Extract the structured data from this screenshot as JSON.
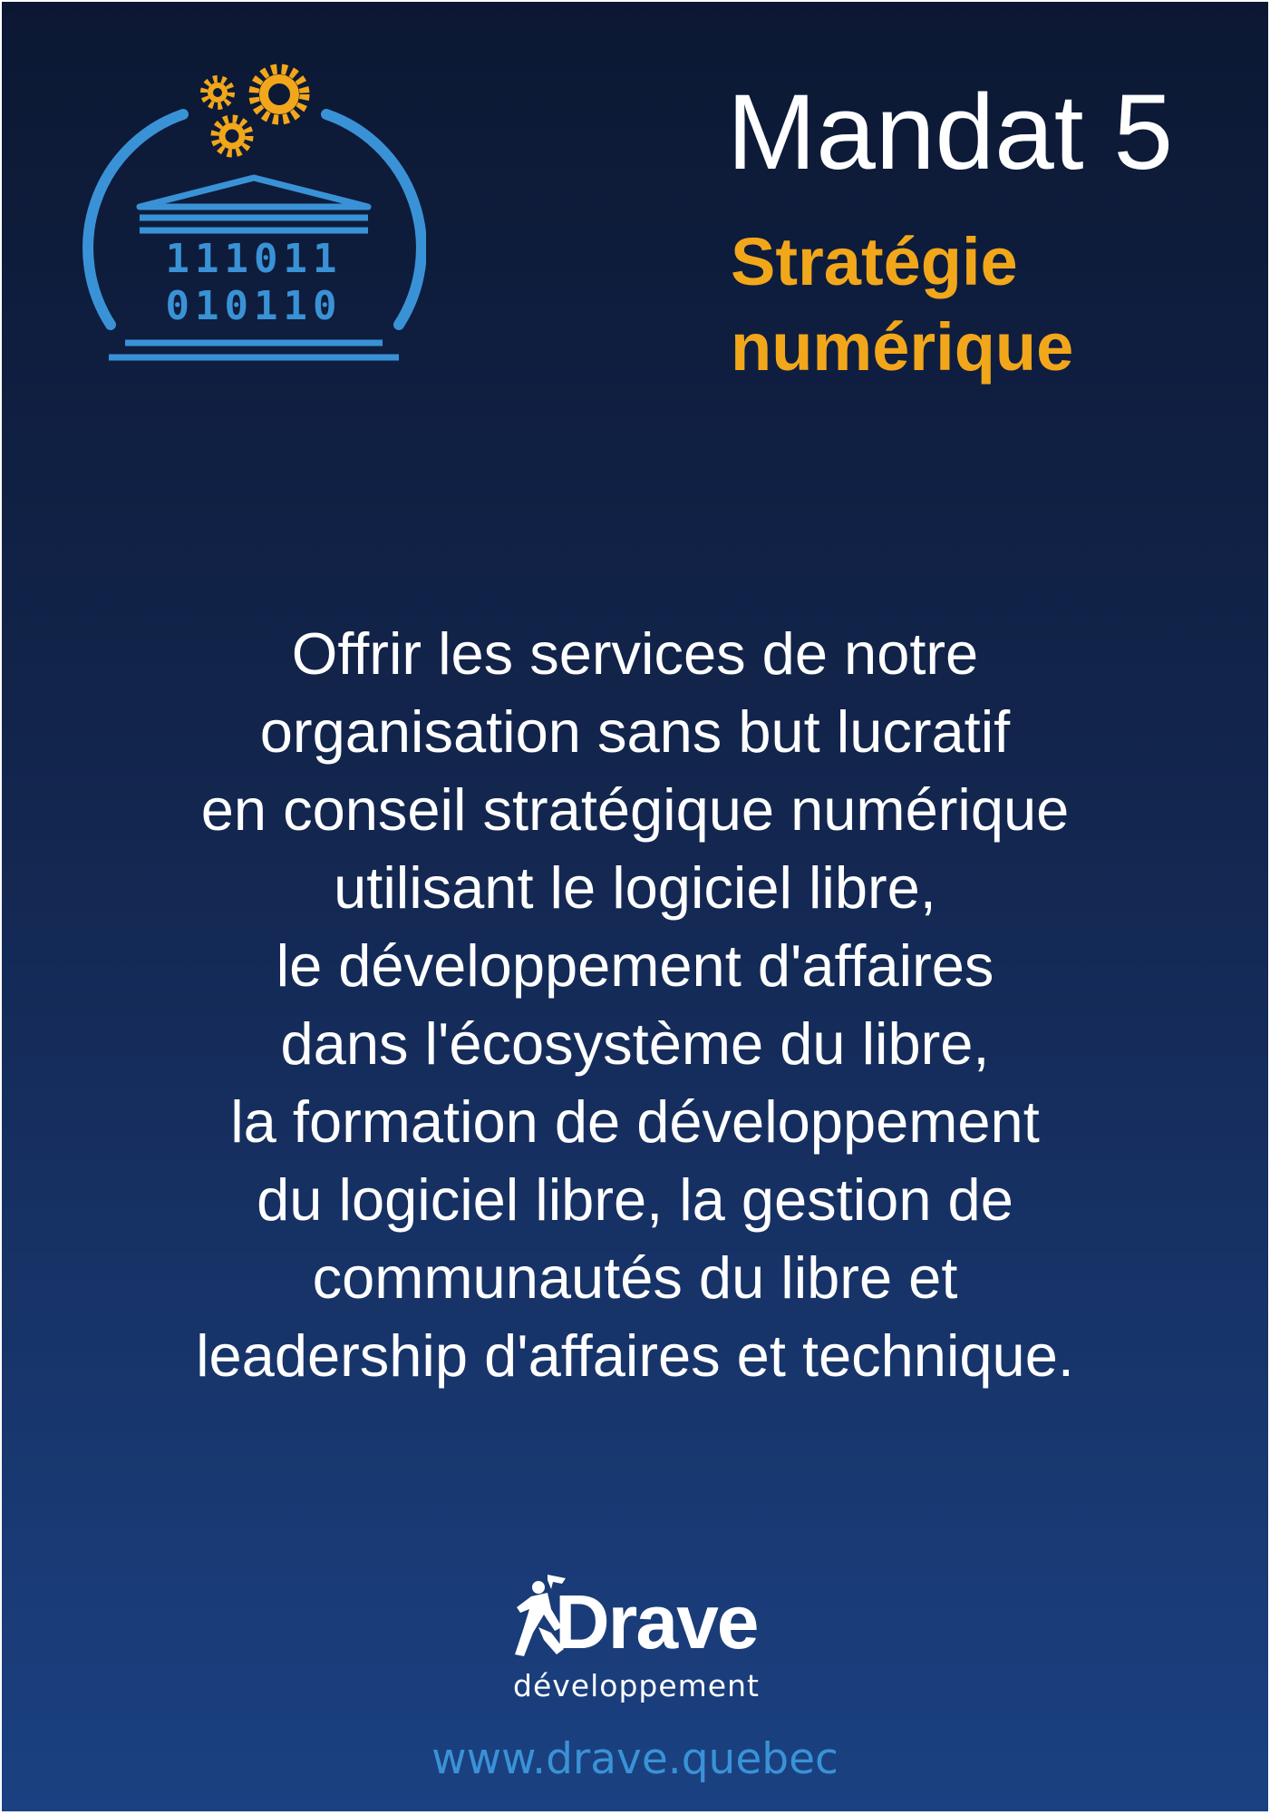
{
  "logo": {
    "icon": "digital-strategy-building-gears-icon",
    "binary_lines": [
      "111011",
      "010110"
    ]
  },
  "header": {
    "title": "Mandat 5",
    "subtitle_lines": [
      "Stratégie",
      "numérique"
    ]
  },
  "body": {
    "lines": [
      "Offrir les services de notre",
      "organisation sans but lucratif",
      "en conseil stratégique numérique",
      "utilisant le logiciel libre,",
      "le développement d'affaires",
      "dans l'écosystème du libre,",
      "la formation de développement",
      "du logiciel libre, la gestion de",
      "communautés du libre et",
      "leadership d'affaires et technique."
    ]
  },
  "brand": {
    "icon": "drave-runner-logo-icon",
    "name": "Drave",
    "tagline": "développement",
    "url": "www.drave.quebec"
  },
  "colors": {
    "background_top": "#0c1833",
    "background_bottom": "#1b4182",
    "accent_orange": "#f2a71b",
    "icon_blue": "#3a92d6",
    "text": "#ffffff"
  }
}
